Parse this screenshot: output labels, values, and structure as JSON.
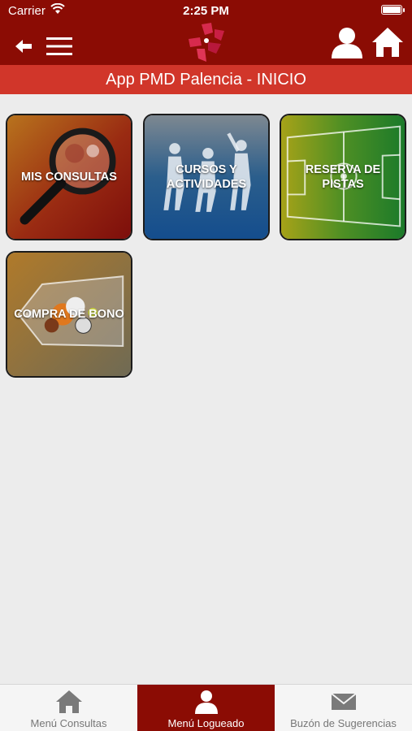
{
  "status_bar": {
    "carrier": "Carrier",
    "time": "2:25 PM"
  },
  "header": {
    "title": "App PMD Palencia - INICIO",
    "icons": [
      "back-arrow-icon",
      "hamburger-menu-icon",
      "logo",
      "user-icon",
      "home-icon"
    ]
  },
  "tiles": [
    {
      "label": "MIS CONSULTAS",
      "icon": "magnifier-icon"
    },
    {
      "label": "CURSOS Y ACTIVIDADES",
      "icon": "athletes-icon"
    },
    {
      "label": "RESERVA DE PISTAS",
      "icon": "soccer-field-icon"
    },
    {
      "label": "COMPRA DE BONO",
      "icon": "balls-ticket-icon"
    }
  ],
  "tabbar": {
    "items": [
      {
        "label": "Menú Consultas",
        "icon": "home-icon",
        "active": false
      },
      {
        "label": "Menú Logueado",
        "icon": "user-icon",
        "active": true
      },
      {
        "label": "Buzón de Sugerencias",
        "icon": "envelope-icon",
        "active": false
      }
    ]
  },
  "colors": {
    "primary": "#8b0c04",
    "title_bar": "#d1362a",
    "background": "#ececec"
  }
}
